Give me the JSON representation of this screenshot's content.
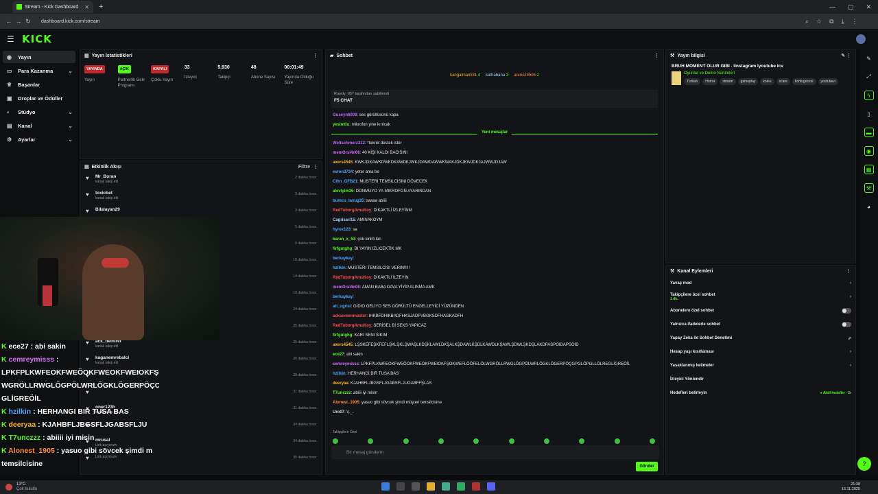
{
  "browser": {
    "tab_title": "Stream - Kick Dashboard",
    "url": "dashboard.kick.com/stream"
  },
  "brand": {
    "logo": "KICK",
    "accent": "#53fc18"
  },
  "sidebar": {
    "items": [
      {
        "label": "Yayın",
        "icon": "broadcast-icon",
        "active": true
      },
      {
        "label": "Para Kazanma",
        "icon": "money-icon",
        "chevron": true
      },
      {
        "label": "Başarılar",
        "icon": "trophy-icon"
      },
      {
        "label": "Droplar ve Ödüller",
        "icon": "gift-icon"
      },
      {
        "label": "Stüdyo",
        "icon": "studio-icon",
        "chevron": true
      },
      {
        "label": "Kanal",
        "icon": "channel-icon",
        "chevron": true
      },
      {
        "label": "Ayarlar",
        "icon": "settings-icon",
        "chevron": true
      }
    ]
  },
  "stats": {
    "title": "Yayın İstatistikleri",
    "items": [
      {
        "badge": "YAYINDA",
        "label": "Yayın"
      },
      {
        "badge": "AÇIK",
        "label": "Partnerlik Gelir Programı"
      },
      {
        "badge": "KAPALI",
        "label": "Çoklu Yayın"
      },
      {
        "value": "33",
        "label": "İzleyici"
      },
      {
        "value": "5.930",
        "label": "Takipçi"
      },
      {
        "value": "48",
        "label": "Abone Sayısı"
      },
      {
        "value": "00:01:49",
        "label": "Yayında Olduğu Süre"
      }
    ]
  },
  "activity": {
    "title": "Etkinlik Akışı",
    "filter": "Filtre",
    "rows": [
      {
        "name": "Mr_Boran",
        "sub": "kanalı takip etti",
        "time": "2 dakika önce"
      },
      {
        "name": "toxicbet",
        "sub": "kanalı takip etti",
        "time": "3 dakika önce"
      },
      {
        "name": "Bilalayan29",
        "sub": "",
        "time": "3 dakika önce"
      },
      {
        "name": "",
        "sub": "",
        "time": "5 dakika önce"
      },
      {
        "name": "",
        "sub": "",
        "time": "6 dakika önce"
      },
      {
        "name": "",
        "sub": "",
        "time": "10 dakika önce"
      },
      {
        "name": "",
        "sub": "",
        "time": "14 dakika önce"
      },
      {
        "name": "",
        "sub": "",
        "time": "19 dakika önce"
      },
      {
        "name": "",
        "sub": "",
        "time": "24 dakika önce"
      },
      {
        "name": "",
        "sub": "",
        "time": "25 dakika önce"
      },
      {
        "name": "ack_demirel",
        "sub": "kanalı takip etti",
        "time": "25 dakika önce"
      },
      {
        "name": "kaganemrebalci",
        "sub": "kanalı takip etti",
        "time": "26 dakika önce"
      },
      {
        "name": "",
        "sub": "",
        "time": "28 dakika önce"
      },
      {
        "name": "",
        "sub": "",
        "time": "31 dakika önce"
      },
      {
        "name": "oner123h",
        "sub": "kanalı takip etti",
        "time": "31 dakika önce"
      },
      {
        "name": "",
        "sub": "",
        "time": "34 dakika önce"
      },
      {
        "name": "mrusal",
        "sub": "Link açıyorum",
        "time": "34 dakika önce"
      },
      {
        "name": "",
        "sub": "Link açıyorum",
        "time": "35 dakika önce"
      }
    ]
  },
  "chat": {
    "title": "Sohbet",
    "top_users": [
      {
        "name": "kangalmami31",
        "count": "4"
      },
      {
        "name": "kathabana",
        "count": "3"
      },
      {
        "name": "arenoz3506",
        "count": "2"
      }
    ],
    "pinned_by": "Rowdy_957 tarafından sabitlendi",
    "pinned_text": "F5 CHAT",
    "new_messages": "Yeni mesajlar",
    "messages": [
      {
        "user": "Guseyn6008",
        "color": "#b86bff",
        "text": ": ses gürültüsünü kapa"
      },
      {
        "user": "yesimtiu",
        "color": "#53fc18",
        "text": ": mikrofon yine kırılcak"
      },
      {
        "divider": true
      },
      {
        "user": "Weltschmerz312",
        "color": "#b86bff",
        "text": ": *teknik destek ister"
      },
      {
        "user": "memOrsl4n06",
        "color": "#d36bff",
        "text": ": 40 KİŞİ KALDI BACISINI"
      },
      {
        "user": "axers4545",
        "color": "#ffb020",
        "text": ": KWKJDKAWKDWKDKAWDKJWKJDAWDAWWKWAKJDKJKWJDKJAJWWJDJAW"
      },
      {
        "user": "evren3734",
        "color": "#4aa8ff",
        "text": ": yeter ama be"
      },
      {
        "user": "Cihn_GFB21",
        "color": "#4aa8ff",
        "text": ": MUSTERI TEMSILCISINI DÖVECEK"
      },
      {
        "user": "alevlyim35",
        "color": "#53fc18",
        "text": ": DONMUYO YA MIKROFON AYARINDAN"
      },
      {
        "user": "bumcu_lavug35",
        "color": "#4aa8ff",
        "text": ": saaaa abiiii"
      },
      {
        "user": "RedTuborgAmuKoy",
        "color": "#ff4f4f",
        "text": ": DİKAKTLİ İZLEYİNM"
      },
      {
        "user": "Cagrisari15",
        "color": "#9fd0ff",
        "text": ": AMINAKOYM"
      },
      {
        "user": "hyrex123",
        "color": "#4aa8ff",
        "text": ": sa"
      },
      {
        "user": "baran_x_53",
        "color": "#53fc18",
        "text": ": çok sinirli lan"
      },
      {
        "user": "firfgutghg",
        "color": "#53fc18",
        "text": ": BI YAYIN IZLICEKTIK MK"
      },
      {
        "user": "berkaykay",
        "color": "#4aa8ff",
        "text": ":"
      },
      {
        "user": "hzilkin",
        "color": "#4aa8ff",
        "text": ": MUSTERI TEMSILCISI VERIN!!!!!"
      },
      {
        "user": "RedTuborgAmuKoy",
        "color": "#ff4f4f",
        "text": ": DİKAKTLİ İLZEYİN"
      },
      {
        "user": "memOrsl4n06",
        "color": "#d36bff",
        "text": ": AMAN BABA DAVA YİYİP ALINMA AMK"
      },
      {
        "user": "berkaykay",
        "color": "#4aa8ff",
        "text": ":"
      },
      {
        "user": "ati_ugrisi",
        "color": "#4aa8ff",
        "text": ": GIDIO GELIYO SES GÖRÜLTÜ ENGELLEYİCİ YÜZÜNDEN"
      },
      {
        "user": "acksoreenmaster",
        "color": "#ff4f4f",
        "text": ": IHKBFDHIKBADFHKSJADFVBGKSDFHAGKADFH"
      },
      {
        "user": "RedTuborgAmuKoy",
        "color": "#ff4f4f",
        "text": ": SERİSEL Bİ SEKS YAPICAZ"
      },
      {
        "user": "firfgutghg",
        "color": "#53fc18",
        "text": ": KARI SENI SIKIM"
      },
      {
        "user": "axers4545",
        "color": "#ffb020",
        "text": ": LŞSKEFEŞKFEFLŞKLŞKLŞWAŞLKDŞKLAWLDKŞALKŞDAWLKŞDLKAWDLKŞAWLŞDWLŞKDŞLAKDPASPOIDAPSOID"
      },
      {
        "user": "ece27",
        "color": "#53fc18",
        "text": ": abi sakin"
      },
      {
        "user": "cemreymisss",
        "color": "#d36bff",
        "text": ": LPKFPLKWFEOKFWEÖOKFWEOKFWEIOKFŞOKWEFLÖÖFELÖLWGRÖLLRWGLÖGPÖLWRLÖGKLÖGERPÖÇGPGLÖPGLLÖLREGLİGREÖİL"
      },
      {
        "user": "hzilkin",
        "color": "#4aa8ff",
        "text": ": HERHANGİ BIR TUSA BAS"
      },
      {
        "user": "deeryaa",
        "color": "#ffb020",
        "text": ": KJAHBFLJBGSFLJGABSFLJUGABFFŞLAS"
      },
      {
        "user": "T7unczzz",
        "color": "#53fc18",
        "text": ": abiiii iyi misin"
      },
      {
        "user": "Alonest_1905",
        "color": "#ff8a3d",
        "text": ": yasuo gibi sövcek şimdi müşteri temsilcisine"
      },
      {
        "user": "Uro07",
        "color": "#dddddd",
        "text": ": \\(._."
      }
    ],
    "followers_only": "Takipçilere Özel",
    "input_placeholder": "Bir mesaj gönderin",
    "send_label": "Gönder"
  },
  "stream_info": {
    "title": "Yayın bilgisi",
    "stream_title": "BRUH MOMENT OLUR GIBI . linstagram lyoutube lcv",
    "category": "Oyunlar ve Demo Sürümleri",
    "tags": [
      "Turkish",
      "Horror",
      "stream",
      "gameplay",
      "korku",
      "scare",
      "korkugecesi",
      "youtubevi"
    ]
  },
  "channel_actions": {
    "title": "Kanal Eylemleri",
    "rows": [
      {
        "label": "Yavaş mod",
        "type": "chevron"
      },
      {
        "label": "Takipçilere özel sohbet",
        "sub": "1 dk.",
        "type": "chevron"
      },
      {
        "label": "Abonelere özel sohbet",
        "type": "toggle"
      },
      {
        "label": "Yalnızca ifadelerle sohbet",
        "type": "toggle"
      },
      {
        "label": "Yapay Zeka ile Sohbet Denetimi",
        "type": "external"
      },
      {
        "label": "Hesap yaşı kısıtlaması",
        "type": "chevron"
      },
      {
        "label": "Yasaklanmış kelimeler",
        "type": "chevron"
      },
      {
        "label": "İzleyici Yönlendir",
        "type": "none"
      },
      {
        "label": "Hedefleri belirleyin",
        "type": "goals",
        "extra": "● Aktif hedefler - 2"
      }
    ]
  },
  "overlay": {
    "lines": [
      {
        "user": "ece27",
        "color": "#ffffff",
        "text": " : abi sakin"
      },
      {
        "user": "cemreymisss",
        "color": "#d36bff",
        "text": " :"
      },
      {
        "user": "",
        "color": "#ffffff",
        "text": "LPKFPLKWFEOKFWEÖOKFWEOKFWEIOKFŞC"
      },
      {
        "user": "",
        "color": "#ffffff",
        "text": "WGRÖLLRWGLÖGPÖLWRLÖGKLÖGERPÖÇC"
      },
      {
        "user": "",
        "color": "#ffffff",
        "text": "GLİGREÖİL"
      },
      {
        "user": "hzilkin",
        "color": "#4aa8ff",
        "text": " : HERHANGI BIR TUSA BAS"
      },
      {
        "user": "deeryaa",
        "color": "#ffb020",
        "text": " : KJAHBFLJBGSFLJGABSFLJU"
      },
      {
        "user": "T7unczzz",
        "color": "#53fc18",
        "text": " : abiiii iyi misin"
      },
      {
        "user": "Alonest_1905",
        "color": "#ff8a3d",
        "text": " : yasuo gibi sövcek şimdi m"
      },
      {
        "user": "",
        "color": "#ffffff",
        "text": "temsilcisine"
      }
    ]
  },
  "taskbar": {
    "weather": "13°C",
    "weather_sub": "Çok bulutlu",
    "time": "21:38",
    "date": "16.11.2025"
  }
}
